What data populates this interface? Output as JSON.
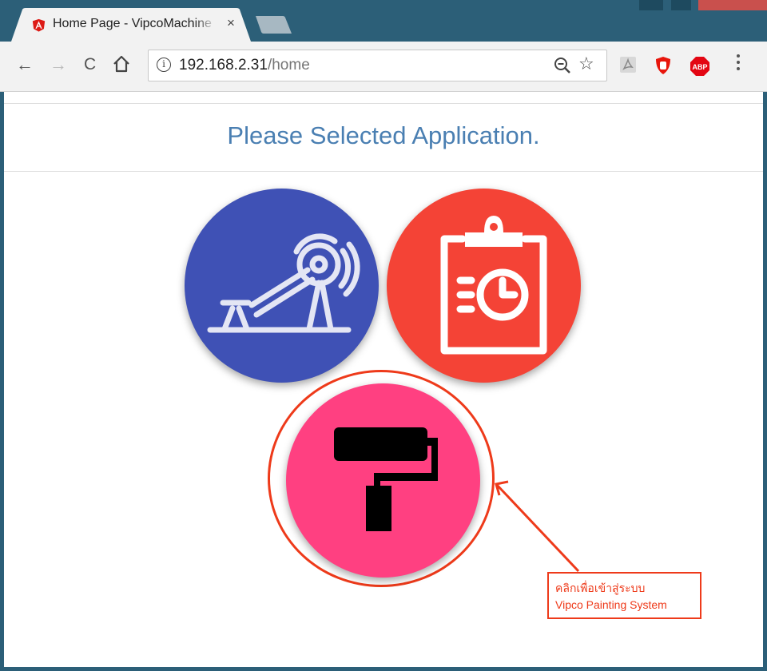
{
  "browser": {
    "tab": {
      "title": "Home Page - VipcoMachine",
      "close_glyph": "×",
      "favicon": "angular-icon"
    },
    "address_bar": {
      "host": "192.168.2.31",
      "path": "/home",
      "info_glyph": "i"
    },
    "nav_icons": {
      "back": "←",
      "forward": "→",
      "reload": "C",
      "home": "⌂"
    },
    "extensions": [
      "pdf-extension-icon",
      "ublock-icon",
      "abp-icon"
    ],
    "abp_label": "ABP",
    "star_glyph": "☆"
  },
  "page": {
    "heading": "Please Selected Application.",
    "apps": [
      {
        "name": "machine-application",
        "icon": "machine-icon",
        "color": "#3f51b5"
      },
      {
        "name": "report-application",
        "icon": "clipboard-clock-icon",
        "color": "#f44336"
      },
      {
        "name": "painting-application",
        "icon": "paint-roller-icon",
        "color": "#ff4081"
      }
    ]
  },
  "annotation": {
    "line1": "คลิกเพื่อเข้าสู่ระบบ",
    "line2": "Vipco Painting System",
    "color": "#ee3a1a"
  }
}
